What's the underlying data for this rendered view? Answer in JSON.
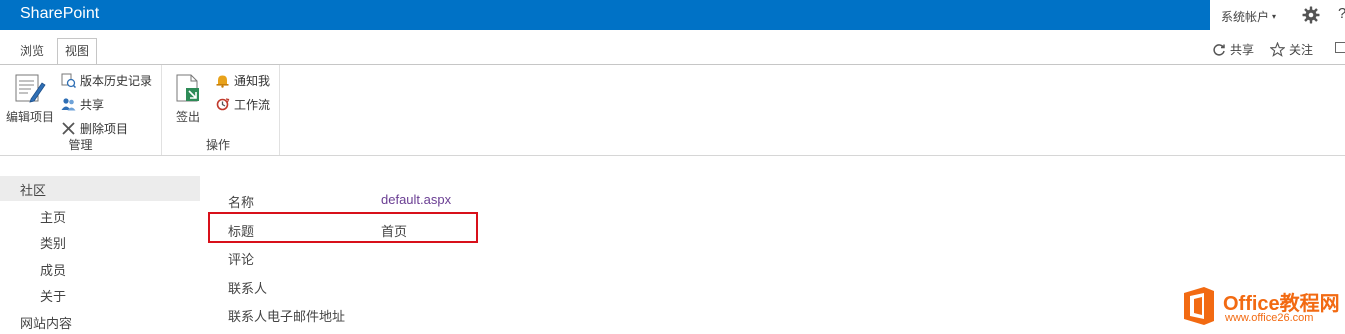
{
  "suitebar": {
    "brand": "SharePoint",
    "account_label": "系统帐户",
    "caret": "▾",
    "settings_icon": "gear-icon",
    "help": "?"
  },
  "tabs": [
    {
      "label": "浏览",
      "active": false
    },
    {
      "label": "视图",
      "active": true
    }
  ],
  "page_actions": {
    "share_label": "共享",
    "follow_label": "关注"
  },
  "ribbon": {
    "groups": [
      {
        "label": "管理",
        "big_button": {
          "label": "编辑项目",
          "icon": "edit-item-icon"
        },
        "small_buttons": [
          {
            "label": "版本历史记录",
            "icon": "version-history-icon"
          },
          {
            "label": "共享",
            "icon": "share-users-icon"
          },
          {
            "label": "删除项目",
            "icon": "delete-x-icon"
          }
        ]
      },
      {
        "label": "操作",
        "big_button": {
          "label": "签出",
          "icon": "checkout-icon"
        },
        "small_buttons": [
          {
            "label": "通知我",
            "icon": "alert-bell-icon"
          },
          {
            "label": "工作流",
            "icon": "workflow-icon"
          }
        ]
      }
    ]
  },
  "leftnav": {
    "heading": "社区",
    "items": [
      "主页",
      "类别",
      "成员",
      "关于"
    ],
    "site_contents": "网站内容"
  },
  "properties": [
    {
      "label": "名称",
      "value": "default.aspx"
    },
    {
      "label": "标题",
      "value": "首页"
    },
    {
      "label": "评论",
      "value": ""
    },
    {
      "label": "联系人",
      "value": ""
    },
    {
      "label": "联系人电子邮件地址",
      "value": ""
    }
  ],
  "watermark": {
    "text": "Office教程网",
    "url": "www.office26.com"
  },
  "colors": {
    "suitebar": "#0072c6",
    "link": "#6a3e93",
    "highlight": "#d8101a",
    "watermark": "#f26a12"
  }
}
